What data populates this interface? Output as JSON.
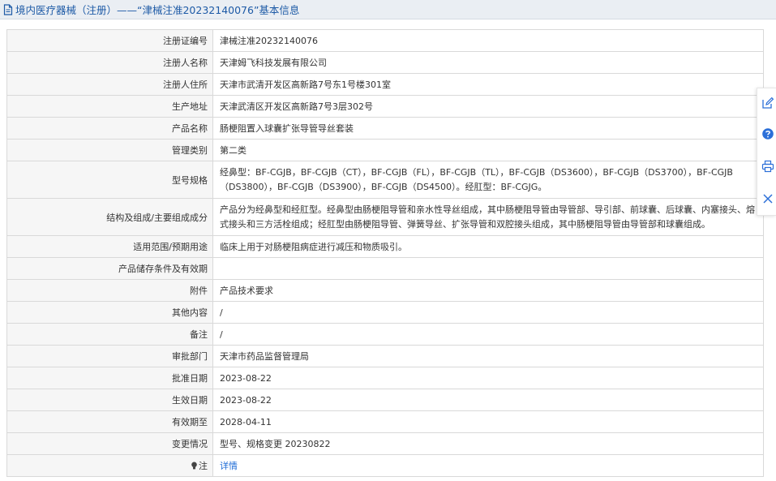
{
  "page_title": "境内医疗器械（注册）——“津械注准20232140076”基本信息",
  "rows": [
    {
      "label": "注册证编号",
      "value": "津械注准20232140076"
    },
    {
      "label": "注册人名称",
      "value": "天津姆飞科技发展有限公司"
    },
    {
      "label": "注册人住所",
      "value": "天津市武清开发区高新路7号东1号楼301室"
    },
    {
      "label": "生产地址",
      "value": "天津武清区开发区高新路7号3层302号"
    },
    {
      "label": "产品名称",
      "value": "肠梗阻置入球囊扩张导管导丝套装"
    },
    {
      "label": "管理类别",
      "value": "第二类"
    },
    {
      "label": "型号规格",
      "value": "经鼻型：BF-CGJB，BF-CGJB（CT），BF-CGJB（FL），BF-CGJB（TL），BF-CGJB（DS3600），BF-CGJB（DS3700），BF-CGJB（DS3800），BF-CGJB（DS3900），BF-CGJB（DS4500）。经肛型：BF-CGJG。"
    },
    {
      "label": "结构及组成/主要组成成分",
      "value": "产品分为经鼻型和经肛型。经鼻型由肠梗阻导管和亲水性导丝组成，其中肠梗阻导管由导管部、导引部、前球囊、后球囊、内塞接头、熔式接头和三方活栓组成；经肛型由肠梗阻导管、弹簧导丝、扩张导管和双腔接头组成，其中肠梗阻导管由导管部和球囊组成。"
    },
    {
      "label": "适用范围/预期用途",
      "value": "临床上用于对肠梗阻病症进行减压和物质吸引。"
    },
    {
      "label": "产品储存条件及有效期",
      "value": ""
    },
    {
      "label": "附件",
      "value": "产品技术要求"
    },
    {
      "label": "其他内容",
      "value": "/"
    },
    {
      "label": "备注",
      "value": "/"
    },
    {
      "label": "审批部门",
      "value": "天津市药品监督管理局"
    },
    {
      "label": "批准日期",
      "value": "2023-08-22"
    },
    {
      "label": "生效日期",
      "value": "2023-08-22"
    },
    {
      "label": "有效期至",
      "value": "2028-04-11"
    },
    {
      "label": "变更情况",
      "value": "型号、规格变更 20230822"
    }
  ],
  "note_row": {
    "label": "注",
    "link_text": "详情"
  },
  "icons": {
    "title": "document-icon",
    "note": "lightbulb-icon",
    "side": [
      "edit-icon",
      "help-icon",
      "print-icon",
      "close-icon"
    ]
  },
  "colors": {
    "link": "#1e6bd6",
    "title": "#1d5aa6",
    "label_bg": "#f6f6f6",
    "border": "#d9d9d9",
    "side_icon": "#2b6fd8"
  }
}
